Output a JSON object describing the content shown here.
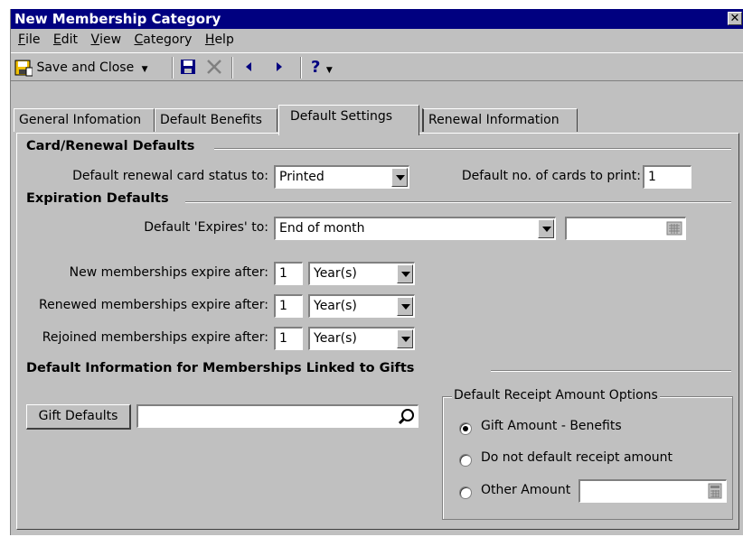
{
  "window": {
    "title": "New Membership Category",
    "close": "✕"
  },
  "menu": [
    "File",
    "Edit",
    "View",
    "Category",
    "Help"
  ],
  "toolbar": {
    "save_close": "Save and Close",
    "help": "?"
  },
  "tabs": [
    "General Infomation",
    "Default Benefits",
    "Default Settings",
    "Renewal Information"
  ],
  "active_tab": "Default Settings",
  "card_renewal": {
    "title": "Card/Renewal Defaults",
    "status_label": "Default renewal card status to:",
    "status_value": "Printed",
    "cards_label": "Default no. of cards to print:",
    "cards_value": "1"
  },
  "expiration": {
    "title": "Expiration Defaults",
    "expires_label": "Default 'Expires' to:",
    "expires_value": "End of month",
    "expires_date": "",
    "new_label": "New memberships expire after:",
    "new_num": "1",
    "new_unit": "Year(s)",
    "renewed_label": "Renewed memberships expire after:",
    "renewed_num": "1",
    "renewed_unit": "Year(s)",
    "rejoined_label": "Rejoined memberships expire after:",
    "rejoined_num": "1",
    "rejoined_unit": "Year(s)"
  },
  "gifts": {
    "title": "Default Information for Memberships Linked to Gifts",
    "button": "Gift Defaults",
    "gift_value": "",
    "receipt_group": "Default Receipt Amount Options",
    "opt1": "Gift Amount - Benefits",
    "opt2": "Do not default receipt amount",
    "opt3": "Other Amount",
    "other_value": "",
    "selected": "Gift Amount - Benefits"
  }
}
